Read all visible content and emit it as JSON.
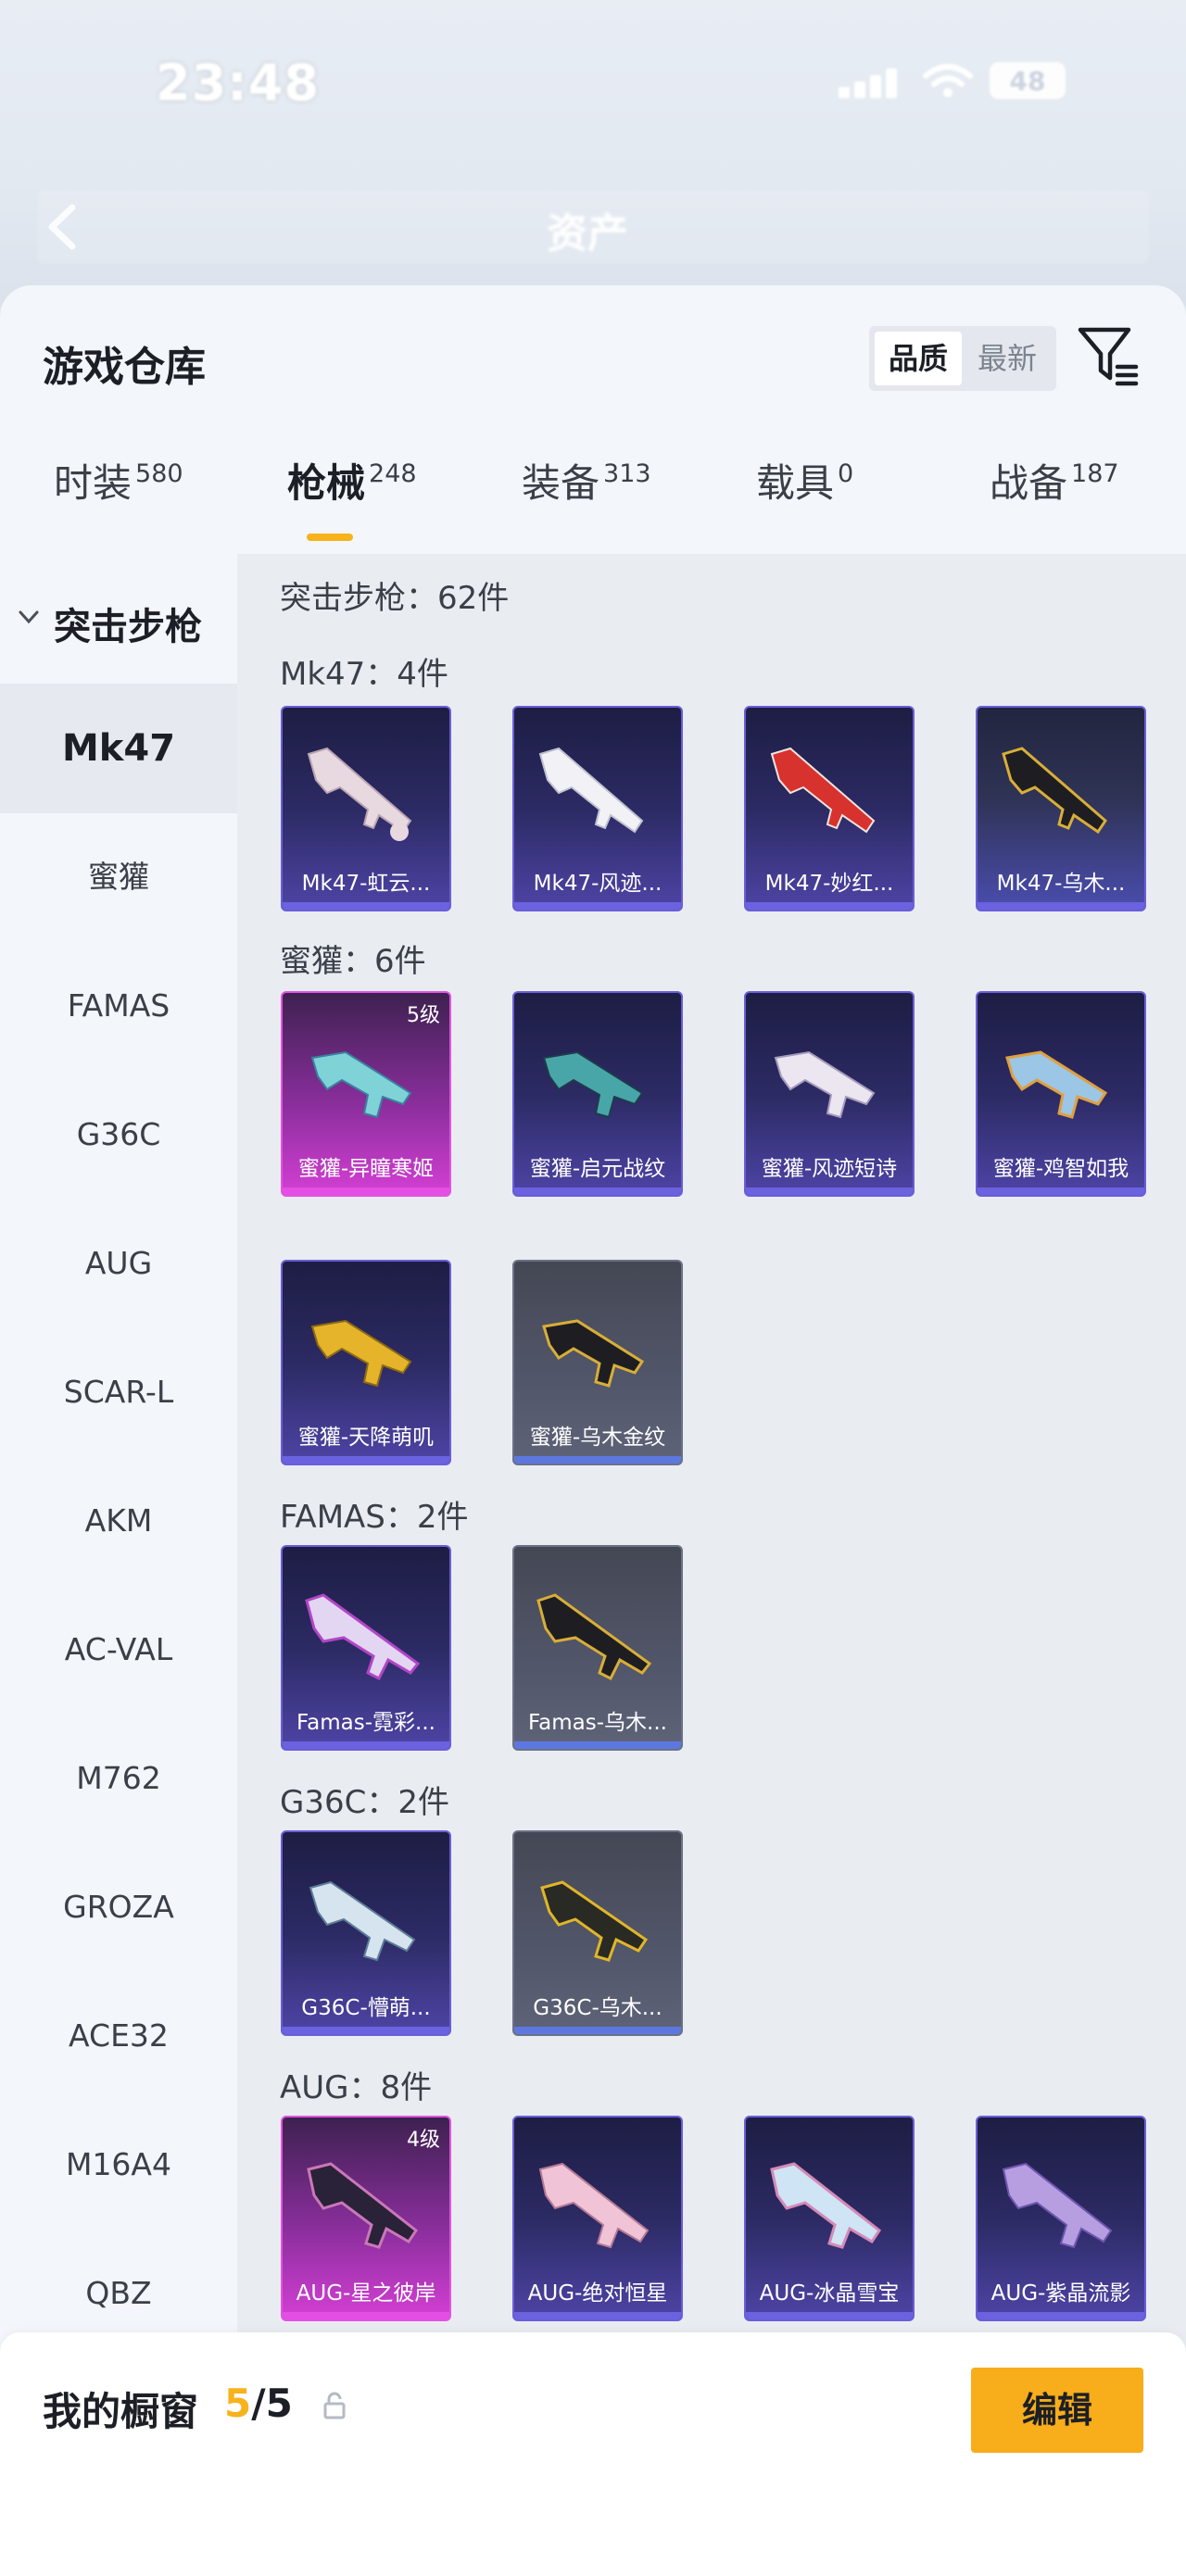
{
  "status_bar": {
    "time": "23:48",
    "battery": "48"
  },
  "header": {
    "title": "资产"
  },
  "sheet": {
    "title": "游戏仓库",
    "sort_options": [
      "品质",
      "最新"
    ],
    "tabs": [
      {
        "label": "时装",
        "count": "580"
      },
      {
        "label": "枪械",
        "count": "248",
        "active": true
      },
      {
        "label": "装备",
        "count": "313"
      },
      {
        "label": "载具",
        "count": "0"
      },
      {
        "label": "战备",
        "count": "187"
      }
    ]
  },
  "sidebar": {
    "group_label": "突击步枪",
    "items": [
      "Mk47",
      "蜜獾",
      "FAMAS",
      "G36C",
      "AUG",
      "SCAR-L",
      "AKM",
      "AC-VAL",
      "M762",
      "GROZA",
      "ACE32",
      "M16A4",
      "QBZ"
    ],
    "active_index": 0
  },
  "content": {
    "title": "突击步枪：62件",
    "sections": [
      {
        "title": "Mk47：4件",
        "items": [
          "Mk47-虹云...",
          "Mk47-风迹...",
          "Mk47-妙红...",
          "Mk47-乌木..."
        ]
      },
      {
        "title": "蜜獾：6件",
        "items": [
          "蜜獾-异瞳寒姬",
          "蜜獾-启元战纹",
          "蜜獾-风迹短诗",
          "蜜獾-鸡智如我",
          "蜜獾-天降萌叽",
          "蜜獾-乌木金纹"
        ],
        "levels": [
          "5级"
        ]
      },
      {
        "title": "FAMAS：2件",
        "items": [
          "Famas-霓彩...",
          "Famas-乌木..."
        ]
      },
      {
        "title": "G36C：2件",
        "items": [
          "G36C-懵萌...",
          "G36C-乌木..."
        ]
      },
      {
        "title": "AUG：8件",
        "items": [
          "AUG-星之彼岸",
          "AUG-绝对恒星",
          "AUG-冰晶雪宝",
          "AUG-紫晶流影"
        ],
        "levels": [
          "4级"
        ]
      }
    ]
  },
  "bottom_bar": {
    "showcase_label": "我的橱窗",
    "showcase_current": "5",
    "showcase_total": "/5",
    "edit_label": "编辑"
  },
  "colors": {
    "accent": "#f8ad1a",
    "card_purple": "#4e44a6",
    "card_pink": "#d43fd4",
    "card_gray": "#5f6378"
  }
}
